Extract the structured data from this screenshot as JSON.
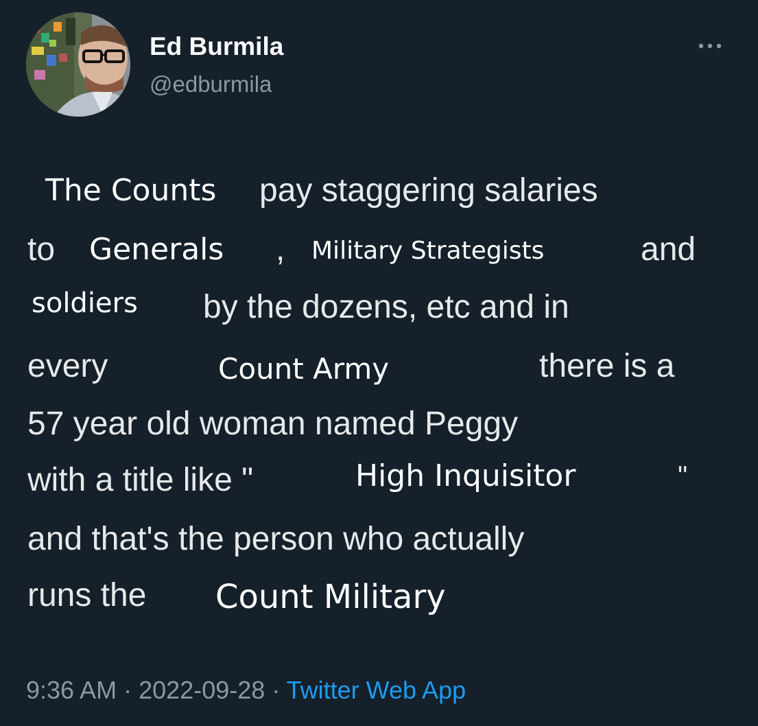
{
  "author": {
    "display_name": "Ed Burmila",
    "handle": "@edburmila"
  },
  "more_icon": "more-horizontal-icon",
  "tweet": {
    "fragments": {
      "l1a": "The Counts",
      "l1b": "pay staggering salaries",
      "l2a": "to",
      "l2b": "Generals",
      "l2c": ",",
      "l2d": "Military Strategists",
      "l2e": "and",
      "l3a": "soldiers",
      "l3b": "by the dozens, etc and in",
      "l4a": "every",
      "l4b": "Count Army",
      "l4c": "there is a",
      "l5a": "57 year old woman named Peggy",
      "l6a": "with a title like \"",
      "l6b": "High Inquisitor",
      "l6c": "\"",
      "l7a": "and that's the person who actually",
      "l8a": "runs the",
      "l8b": "Count Military"
    }
  },
  "meta": {
    "time": "9:36 AM",
    "separator": "·",
    "date": "2022-09-28",
    "source": "Twitter Web App"
  },
  "colors": {
    "background": "#15202b",
    "text": "#e7e9ea",
    "secondary": "#8b98a5",
    "link": "#1d9bf0"
  }
}
